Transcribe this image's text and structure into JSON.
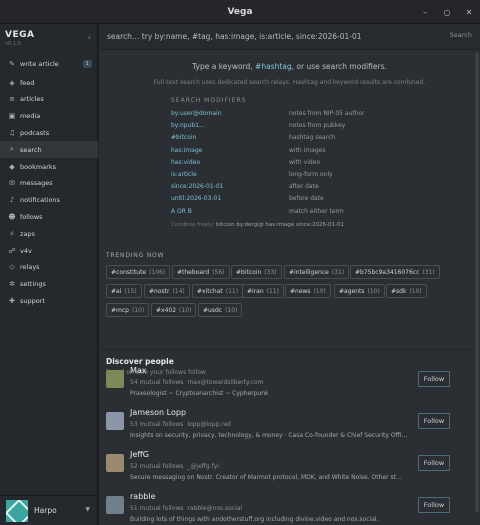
{
  "window": {
    "title": "Vega",
    "controls": [
      "–",
      "○",
      "✕"
    ]
  },
  "sidebar": {
    "brand": "VEGA",
    "version": "v0.1.0",
    "collapse_icon": "‹",
    "items": [
      {
        "icon": "✎",
        "label": "write article",
        "badge": "1"
      },
      {
        "icon": "◈",
        "label": "feed"
      },
      {
        "icon": "≡",
        "label": "articles"
      },
      {
        "icon": "▣",
        "label": "media"
      },
      {
        "icon": "♫",
        "label": "podcasts"
      },
      {
        "icon": "⌕",
        "label": "search",
        "active": true
      },
      {
        "icon": "◆",
        "label": "bookmarks"
      },
      {
        "icon": "✉",
        "label": "messages"
      },
      {
        "icon": "♪",
        "label": "notifications"
      },
      {
        "icon": "☻",
        "label": "follows"
      },
      {
        "icon": "⚡",
        "label": "zaps"
      },
      {
        "icon": "☍",
        "label": "v4v"
      },
      {
        "icon": "◇",
        "label": "relays"
      },
      {
        "icon": "✲",
        "label": "settings"
      },
      {
        "icon": "✚",
        "label": "support"
      }
    ],
    "user": {
      "name": "Harpo",
      "chevron": "▼"
    }
  },
  "search": {
    "placeholder": "search… try by:name, #tag, has:image, is:article, since:2026-01-01",
    "button": "Search"
  },
  "hint": {
    "line1_pre": "Type a keyword, ",
    "line1_tag": "#hashtag",
    "line1_post": ", or use search modifiers.",
    "line2": "Full-text search uses dedicated search relays. Hashtag and keyword results are combined."
  },
  "modifiers": {
    "heading": "SEARCH MODIFIERS",
    "rows": [
      {
        "key": "by:user@domain",
        "desc": "notes from NIP-05 author"
      },
      {
        "key": "by:npub1...",
        "desc": "notes from pubkey"
      },
      {
        "key": "#bitcoin",
        "desc": "hashtag search"
      },
      {
        "key": "has:image",
        "desc": "with images"
      },
      {
        "key": "has:video",
        "desc": "with video"
      },
      {
        "key": "is:article",
        "desc": "long-form only"
      },
      {
        "key": "since:2026-01-01",
        "desc": "after date"
      },
      {
        "key": "until:2026-03-01",
        "desc": "before date"
      },
      {
        "key": "A OR B",
        "desc": "match either term"
      }
    ],
    "combine_label": "Combine freely:",
    "combine_example": "bitcoin by:dergigi has:image since:2026-01-01"
  },
  "trending": {
    "heading": "TRENDING NOW",
    "chips": [
      {
        "tag": "#constitute",
        "count": "(106)"
      },
      {
        "tag": "#theboard",
        "count": "(56)"
      },
      {
        "tag": "#bitcoin",
        "count": "(33)"
      },
      {
        "tag": "#intelligence",
        "count": "(31)"
      },
      {
        "tag": "#b75bc9a3416076cc",
        "count": "(31)"
      },
      {
        "tag": "#ai",
        "count": "(15)"
      },
      {
        "tag": "#nostr",
        "count": "(14)"
      },
      {
        "tag": "#xitchat",
        "count": "(11)"
      },
      {
        "tag": "#iran",
        "count": "(11)"
      },
      {
        "tag": "#news",
        "count": "(10)"
      },
      {
        "tag": "#agents",
        "count": "(10)"
      },
      {
        "tag": "#sdk",
        "count": "(10)"
      },
      {
        "tag": "#mcp",
        "count": "(10)"
      },
      {
        "tag": "#x402",
        "count": "(10)"
      },
      {
        "tag": "#usdc",
        "count": "(10)"
      }
    ]
  },
  "discover": {
    "title": "Discover people",
    "subtitle": "Based on who your follows follow",
    "people": [
      {
        "name": "Max",
        "mutual": "54 mutual follows",
        "nip05": "max@towardsliberty.com",
        "bio": "Praxeologist ~ Cryptoanarchist ~ Cypherpunk",
        "follow": "Follow",
        "avatar_color": "#7c8a5a"
      },
      {
        "name": "Jameson Lopp",
        "mutual": "53 mutual follows",
        "nip05": "lopp@lopp.net",
        "bio": "Insights on security, privacy, technology, & money · Casa Co-founder & Chief Security Offi…",
        "follow": "Follow",
        "avatar_color": "#8b96a8"
      },
      {
        "name": "JeffG",
        "mutual": "52 mutual follows",
        "nip05": "_@jeffg.fyi",
        "bio": "Secure messaging on Nostr. Creator of Marmot protocol, MDK, and White Noise. Other st…",
        "follow": "Follow",
        "avatar_color": "#9a8a70"
      },
      {
        "name": "rabble",
        "mutual": "51 mutual follows",
        "nip05": "rabble@nos.social",
        "bio": "Building lots of things with andotherstuff.org including divine.video and nos.social.",
        "follow": "Follow",
        "avatar_color": "#6f7f8c"
      }
    ]
  }
}
